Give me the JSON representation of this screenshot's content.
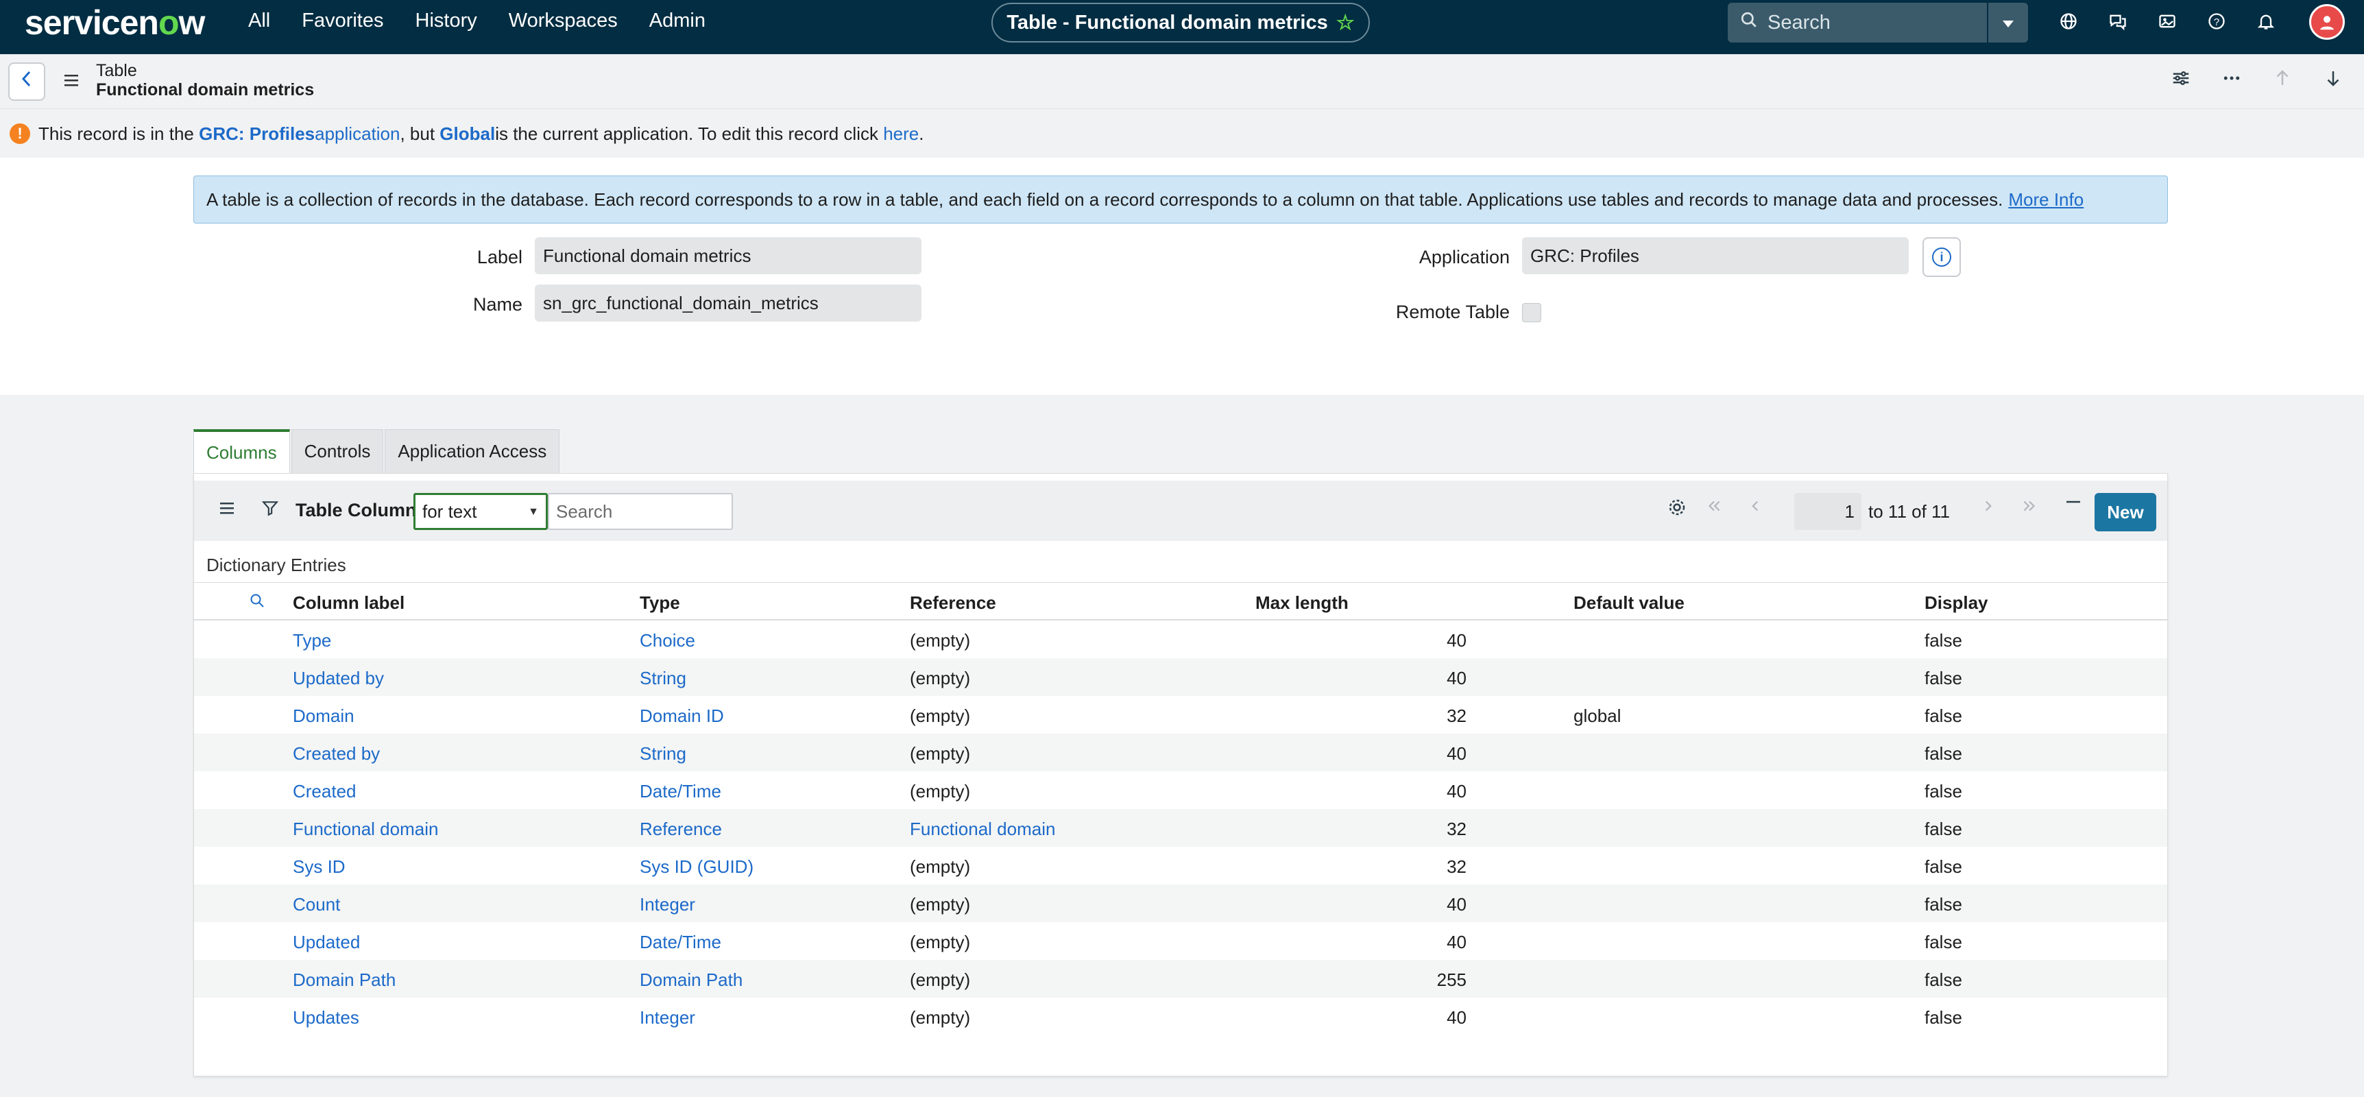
{
  "nav": {
    "logo_text": "servicenow",
    "menu": [
      "All",
      "Favorites",
      "History",
      "Workspaces",
      "Admin"
    ],
    "context_title": "Table - Functional domain metrics",
    "search_placeholder": "Search"
  },
  "record": {
    "table_label": "Table",
    "record_title": "Functional domain metrics"
  },
  "notice": {
    "prefix": "This record is in the ",
    "app_name": "GRC: Profiles",
    "app_word": " application",
    "middle": ", but ",
    "current_app": "Global",
    "suffix": " is the current application. To edit this record click ",
    "here_link": "here",
    "end": "."
  },
  "info": {
    "text": "A table is a collection of records in the database. Each record corresponds to a row in a table, and each field on a record corresponds to a column on that table. Applications use tables and records to manage data and processes.",
    "more_info": "More Info"
  },
  "form": {
    "label_label": "Label",
    "label_value": "Functional domain metrics",
    "name_label": "Name",
    "name_value": "sn_grc_functional_domain_metrics",
    "application_label": "Application",
    "application_value": "GRC: Profiles",
    "remote_table_label": "Remote Table",
    "remote_table_checked": false
  },
  "tabs": [
    {
      "label": "Columns",
      "active": true
    },
    {
      "label": "Controls",
      "active": false
    },
    {
      "label": "Application Access",
      "active": false
    }
  ],
  "related_list": {
    "title": "Table Columns",
    "filter_select": "for text",
    "search_placeholder": "Search",
    "pagination": {
      "current": "1",
      "text": "to 11 of 11"
    },
    "new_label": "New",
    "section_label": "Dictionary Entries",
    "headers": [
      "Column label",
      "Type",
      "Reference",
      "Max length",
      "Default value",
      "Display"
    ],
    "rows": [
      {
        "label": "Type",
        "type": "Choice",
        "reference": "(empty)",
        "ref_link": false,
        "max_length": "40",
        "default": "",
        "display": "false"
      },
      {
        "label": "Updated by",
        "type": "String",
        "reference": "(empty)",
        "ref_link": false,
        "max_length": "40",
        "default": "",
        "display": "false"
      },
      {
        "label": "Domain",
        "type": "Domain ID",
        "reference": "(empty)",
        "ref_link": false,
        "max_length": "32",
        "default": "global",
        "display": "false"
      },
      {
        "label": "Created by",
        "type": "String",
        "reference": "(empty)",
        "ref_link": false,
        "max_length": "40",
        "default": "",
        "display": "false"
      },
      {
        "label": "Created",
        "type": "Date/Time",
        "reference": "(empty)",
        "ref_link": false,
        "max_length": "40",
        "default": "",
        "display": "false"
      },
      {
        "label": "Functional domain",
        "type": "Reference",
        "reference": "Functional domain",
        "ref_link": true,
        "max_length": "32",
        "default": "",
        "display": "false"
      },
      {
        "label": "Sys ID",
        "type": "Sys ID (GUID)",
        "reference": "(empty)",
        "ref_link": false,
        "max_length": "32",
        "default": "",
        "display": "false"
      },
      {
        "label": "Count",
        "type": "Integer",
        "reference": "(empty)",
        "ref_link": false,
        "max_length": "40",
        "default": "",
        "display": "false"
      },
      {
        "label": "Updated",
        "type": "Date/Time",
        "reference": "(empty)",
        "ref_link": false,
        "max_length": "40",
        "default": "",
        "display": "false"
      },
      {
        "label": "Domain Path",
        "type": "Domain Path",
        "reference": "(empty)",
        "ref_link": false,
        "max_length": "255",
        "default": "",
        "display": "false"
      },
      {
        "label": "Updates",
        "type": "Integer",
        "reference": "(empty)",
        "ref_link": false,
        "max_length": "40",
        "default": "",
        "display": "false"
      }
    ]
  },
  "colors": {
    "nav_bg": "#032d42",
    "accent_green": "#62d84e",
    "link_blue": "#1c6ac9",
    "new_button": "#1c76a2",
    "warning": "#f58220"
  }
}
